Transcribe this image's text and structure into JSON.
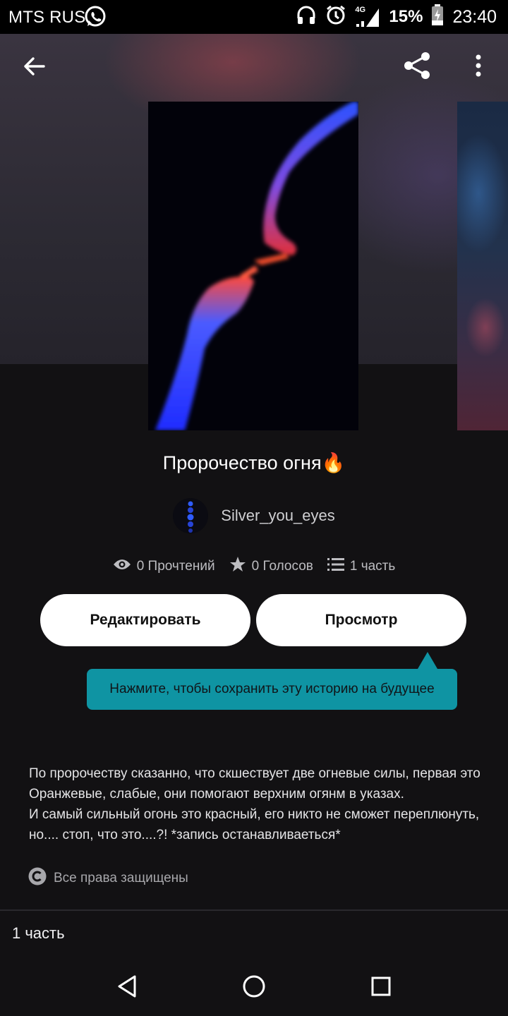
{
  "status_bar": {
    "carrier": "MTS RUS",
    "network": "4G",
    "battery_percent": "15%",
    "time": "23:40",
    "icons": [
      "whatsapp-icon",
      "headphones-icon",
      "alarm-icon",
      "signal-icon",
      "battery-charging-icon"
    ]
  },
  "toolbar": {
    "back_icon": "arrow-left-icon",
    "share_icon": "share-icon",
    "more_icon": "more-vertical-icon"
  },
  "story": {
    "title": "Пророчество огня",
    "title_emoji": "🔥",
    "author": "Silver_you_eyes",
    "stats": {
      "reads": "0 Прочтений",
      "votes": "0 Голосов",
      "parts": "1 часть"
    },
    "description": [
      "По пророчеству сказанно, что скшествует две огневые силы, первая это Оранжевые, слабые, они помогают верхним огянм в указах.",
      "И самый сильный огонь это красный, его никто не сможет переплюнуть, но.... стоп, что это....?! *запись останавливаеться*"
    ],
    "rights": "Все права защищены",
    "parts_header": "1 часть"
  },
  "actions": {
    "edit_label": "Редактировать",
    "view_label": "Просмотр"
  },
  "tooltip": {
    "text": "Нажмите, чтобы сохранить эту историю на будущее",
    "color": "#0f94a3"
  },
  "nav_bar": {
    "icons": [
      "nav-back-icon",
      "nav-home-icon",
      "nav-recents-icon"
    ]
  }
}
